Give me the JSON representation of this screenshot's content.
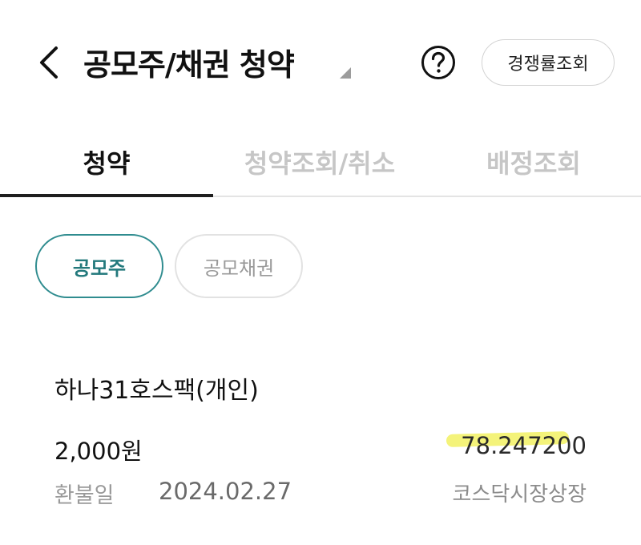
{
  "header": {
    "back_icon": "chevron-left-icon",
    "title": "공모주/채권 청약",
    "title_caret_icon": "dropdown-triangle-icon",
    "help_icon": "question-circle-icon",
    "rate_button_label": "경쟁률조회"
  },
  "tabs": [
    {
      "label": "청약",
      "active": true
    },
    {
      "label": "청약조회/취소",
      "active": false
    },
    {
      "label": "배정조회",
      "active": false
    }
  ],
  "segments": [
    {
      "label": "공모주",
      "selected": true
    },
    {
      "label": "공모채권",
      "selected": false
    }
  ],
  "item": {
    "name": "하나31호스팩(개인)",
    "price": "2,000원",
    "rate": "78.247200",
    "refund_label": "환불일",
    "refund_date": "2024.02.27",
    "market": "코스닥시장상장"
  },
  "colors": {
    "accent": "#2f8c8f",
    "highlight": "#f4f37a",
    "inactive_tab": "#c6c6c6"
  }
}
